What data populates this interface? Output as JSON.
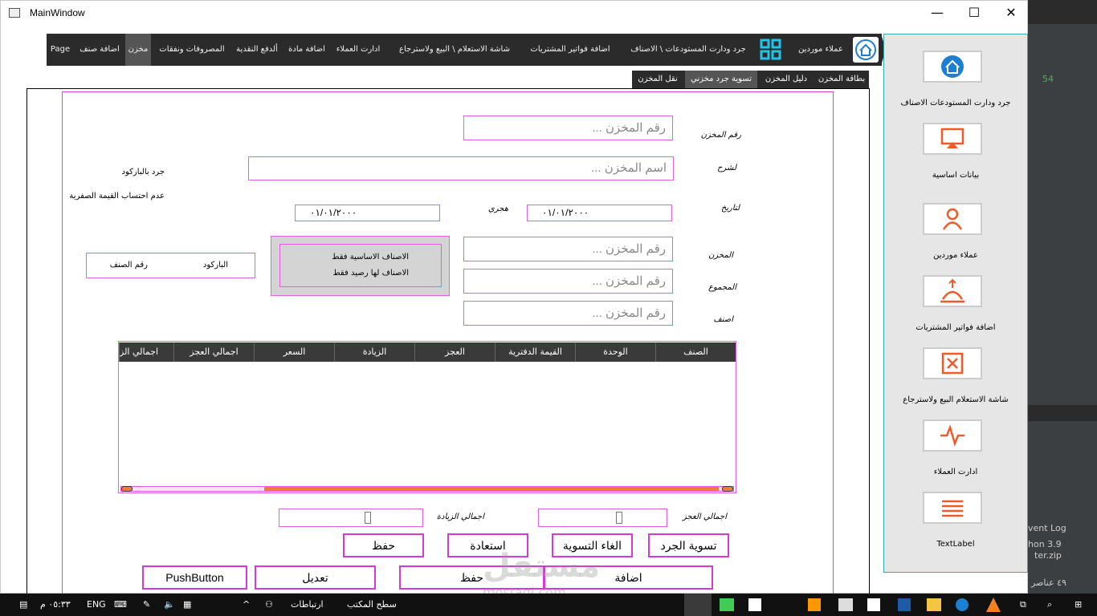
{
  "window": {
    "title": "MainWindow",
    "minimize": "—",
    "maximize": "☐",
    "close": "✕"
  },
  "nav": {
    "items": [
      "عملاء موردين",
      "جرد ودارت المستودعات \\ الاصناف",
      "اضافة فواتير المشتريات",
      "شاشة الاستعلام \\ البيع ولاسترجاع",
      "ادارت العملاء",
      "اضافة مادة",
      "ألدفع النقدية",
      "المصروفات ونفقات",
      "مخزن",
      "اضافة صنف",
      "Page"
    ]
  },
  "tabs": [
    "بطاقة المخزن",
    "دليل المخزن",
    "تسوية جرد مخزني",
    "نقل المخزن"
  ],
  "form": {
    "store_no_label": "رقم المخزن",
    "desc_label": "لشرح",
    "date_label": "لتاريخ",
    "hijri_label": "هجري",
    "store_label": "المخزن",
    "group_label": "المجموع",
    "item_label": "اصنف",
    "placeholder": "رقم المخزن ...",
    "name_placeholder": "اسم المخزن ...",
    "date_value": "٠١/٠١/٢٠٠٠",
    "hijri_value": "٠١/٠١/٢٠٠٠",
    "barcode_count": "جرد بالباركود",
    "no_zero": "عدم احتساب القيمة الصفرية",
    "basic_only": "الاصناف الاساسية فقط",
    "with_balance": "الاصناف لها رصيد فقط",
    "barcode": "الباركود",
    "item_no": "رقم الصنف",
    "total_increase": "اجمالي الزيادة",
    "total_deficit": "اجمالي العجز"
  },
  "table": {
    "columns": [
      "الصنف",
      "الوحدة",
      "القيمة الدفترية",
      "العجز",
      "الزيادة",
      "السعر",
      "اجمالي العجز",
      "اجمالي الز"
    ]
  },
  "buttons": {
    "settle": "تسوية الجرد",
    "cancel_settle": "الغاء التسوية",
    "restore": "استعادة",
    "save1": "حفظ",
    "add": "اضافة",
    "save2": "حفظ",
    "edit": "تعديل",
    "push": "PushButton"
  },
  "sidebar": {
    "items": [
      "جرد ودارت المستودعات   الاصناف",
      "بيانات اساسية",
      "عملاء موردين",
      "اضافة فواتير المشتريات",
      "شاشة الاستعلام  البيع ولاسترجاع",
      "ادارت العملاء",
      "TextLabel"
    ]
  },
  "taskbar": {
    "time": "٠٥:٣٣ م",
    "lang": "ENG",
    "links": "ارتباطات",
    "desktop": "سطح المكتب"
  },
  "ide": {
    "count": "54",
    "event_log": "vent Log",
    "python": "hon 3.9",
    "zip": "ter.zip",
    "items": "٤٩ عناصر"
  },
  "watermark": {
    "text": "مستقل",
    "sub": "mostaql.com"
  },
  "colors": {
    "accent": "#e55ee5",
    "orange": "#f05a28",
    "nav": "#2b2b2b"
  }
}
